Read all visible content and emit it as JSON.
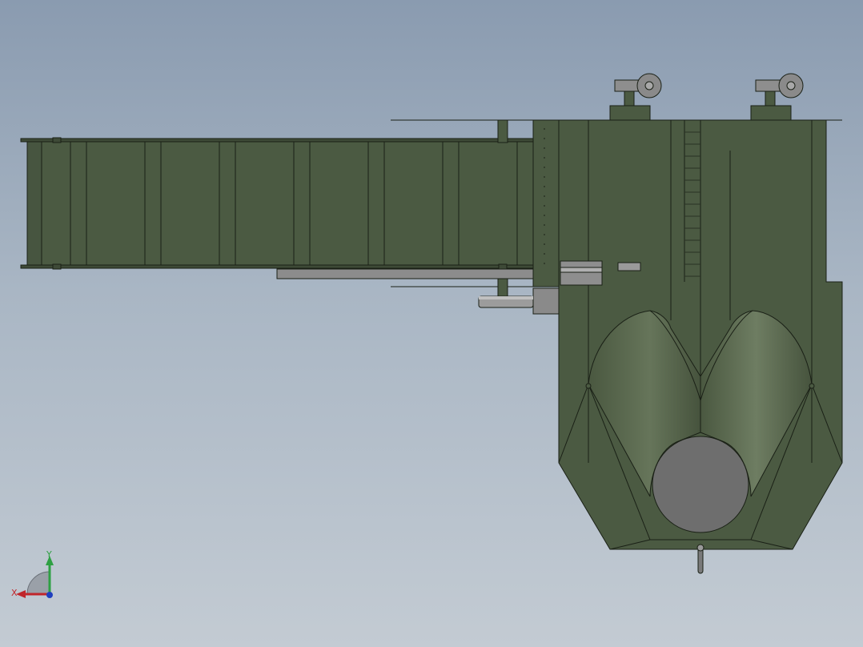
{
  "viewport": {
    "background_top": "#8a9bb0",
    "background_bottom": "#c3cbd3"
  },
  "model": {
    "body_color": "#4b5a42",
    "edge_color": "#1a2016",
    "highlight_color": "#6d7b60",
    "gray_part_color": "#6e6e6e",
    "light_gray_color": "#a0a0a0"
  },
  "triad": {
    "x_label": "X",
    "y_label": "Y",
    "x_color": "#c0262b",
    "y_color": "#2ea043",
    "z_color": "#1f3fbf"
  }
}
